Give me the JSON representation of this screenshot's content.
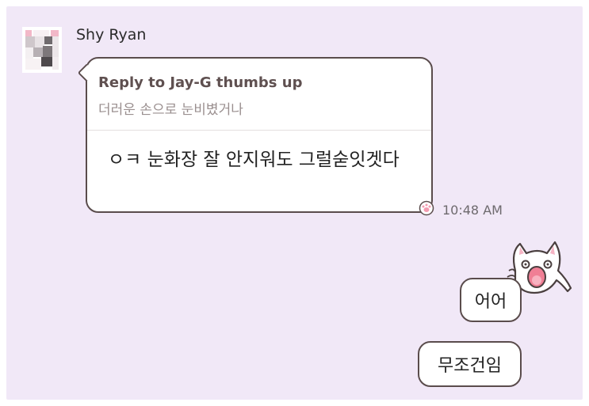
{
  "chat": {
    "sender_name": "Shy Ryan",
    "incoming": {
      "reply_title": "Reply to Jay-G thumbs up",
      "reply_quote": "더러운 손으로 눈비볐거나",
      "text": "ㅇㅋ 눈화장 잘 안지워도 그럴숟잇겟다",
      "time": "10:48 AM"
    },
    "outgoing": [
      {
        "text": "어어"
      },
      {
        "text": "무조건임"
      }
    ]
  },
  "icons": {
    "avatar": "pixelated-avatar",
    "reaction": "paw-icon",
    "sticker": "cat-sticker"
  },
  "colors": {
    "background": "#f1e8f7",
    "bubble_border": "#5a4c4c",
    "bubble_fill": "#ffffff"
  }
}
